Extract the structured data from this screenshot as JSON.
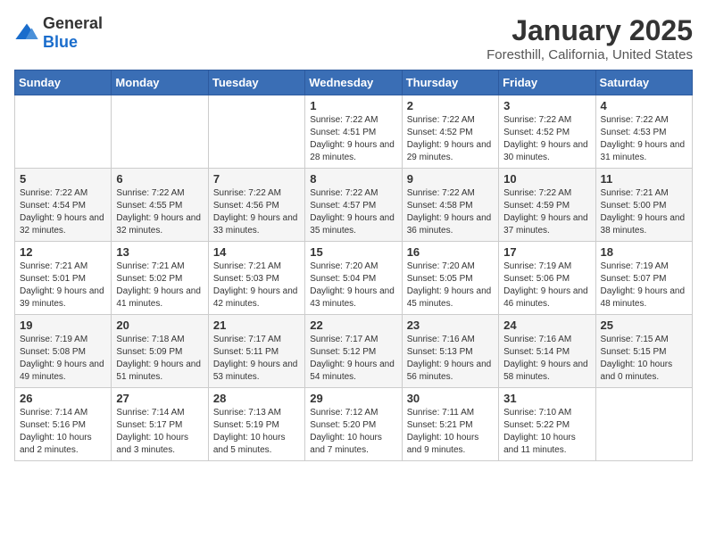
{
  "logo": {
    "general": "General",
    "blue": "Blue"
  },
  "title": "January 2025",
  "subtitle": "Foresthill, California, United States",
  "weekdays": [
    "Sunday",
    "Monday",
    "Tuesday",
    "Wednesday",
    "Thursday",
    "Friday",
    "Saturday"
  ],
  "weeks": [
    [
      {
        "day": "",
        "info": ""
      },
      {
        "day": "",
        "info": ""
      },
      {
        "day": "",
        "info": ""
      },
      {
        "day": "1",
        "info": "Sunrise: 7:22 AM\nSunset: 4:51 PM\nDaylight: 9 hours and 28 minutes."
      },
      {
        "day": "2",
        "info": "Sunrise: 7:22 AM\nSunset: 4:52 PM\nDaylight: 9 hours and 29 minutes."
      },
      {
        "day": "3",
        "info": "Sunrise: 7:22 AM\nSunset: 4:52 PM\nDaylight: 9 hours and 30 minutes."
      },
      {
        "day": "4",
        "info": "Sunrise: 7:22 AM\nSunset: 4:53 PM\nDaylight: 9 hours and 31 minutes."
      }
    ],
    [
      {
        "day": "5",
        "info": "Sunrise: 7:22 AM\nSunset: 4:54 PM\nDaylight: 9 hours and 32 minutes."
      },
      {
        "day": "6",
        "info": "Sunrise: 7:22 AM\nSunset: 4:55 PM\nDaylight: 9 hours and 32 minutes."
      },
      {
        "day": "7",
        "info": "Sunrise: 7:22 AM\nSunset: 4:56 PM\nDaylight: 9 hours and 33 minutes."
      },
      {
        "day": "8",
        "info": "Sunrise: 7:22 AM\nSunset: 4:57 PM\nDaylight: 9 hours and 35 minutes."
      },
      {
        "day": "9",
        "info": "Sunrise: 7:22 AM\nSunset: 4:58 PM\nDaylight: 9 hours and 36 minutes."
      },
      {
        "day": "10",
        "info": "Sunrise: 7:22 AM\nSunset: 4:59 PM\nDaylight: 9 hours and 37 minutes."
      },
      {
        "day": "11",
        "info": "Sunrise: 7:21 AM\nSunset: 5:00 PM\nDaylight: 9 hours and 38 minutes."
      }
    ],
    [
      {
        "day": "12",
        "info": "Sunrise: 7:21 AM\nSunset: 5:01 PM\nDaylight: 9 hours and 39 minutes."
      },
      {
        "day": "13",
        "info": "Sunrise: 7:21 AM\nSunset: 5:02 PM\nDaylight: 9 hours and 41 minutes."
      },
      {
        "day": "14",
        "info": "Sunrise: 7:21 AM\nSunset: 5:03 PM\nDaylight: 9 hours and 42 minutes."
      },
      {
        "day": "15",
        "info": "Sunrise: 7:20 AM\nSunset: 5:04 PM\nDaylight: 9 hours and 43 minutes."
      },
      {
        "day": "16",
        "info": "Sunrise: 7:20 AM\nSunset: 5:05 PM\nDaylight: 9 hours and 45 minutes."
      },
      {
        "day": "17",
        "info": "Sunrise: 7:19 AM\nSunset: 5:06 PM\nDaylight: 9 hours and 46 minutes."
      },
      {
        "day": "18",
        "info": "Sunrise: 7:19 AM\nSunset: 5:07 PM\nDaylight: 9 hours and 48 minutes."
      }
    ],
    [
      {
        "day": "19",
        "info": "Sunrise: 7:19 AM\nSunset: 5:08 PM\nDaylight: 9 hours and 49 minutes."
      },
      {
        "day": "20",
        "info": "Sunrise: 7:18 AM\nSunset: 5:09 PM\nDaylight: 9 hours and 51 minutes."
      },
      {
        "day": "21",
        "info": "Sunrise: 7:17 AM\nSunset: 5:11 PM\nDaylight: 9 hours and 53 minutes."
      },
      {
        "day": "22",
        "info": "Sunrise: 7:17 AM\nSunset: 5:12 PM\nDaylight: 9 hours and 54 minutes."
      },
      {
        "day": "23",
        "info": "Sunrise: 7:16 AM\nSunset: 5:13 PM\nDaylight: 9 hours and 56 minutes."
      },
      {
        "day": "24",
        "info": "Sunrise: 7:16 AM\nSunset: 5:14 PM\nDaylight: 9 hours and 58 minutes."
      },
      {
        "day": "25",
        "info": "Sunrise: 7:15 AM\nSunset: 5:15 PM\nDaylight: 10 hours and 0 minutes."
      }
    ],
    [
      {
        "day": "26",
        "info": "Sunrise: 7:14 AM\nSunset: 5:16 PM\nDaylight: 10 hours and 2 minutes."
      },
      {
        "day": "27",
        "info": "Sunrise: 7:14 AM\nSunset: 5:17 PM\nDaylight: 10 hours and 3 minutes."
      },
      {
        "day": "28",
        "info": "Sunrise: 7:13 AM\nSunset: 5:19 PM\nDaylight: 10 hours and 5 minutes."
      },
      {
        "day": "29",
        "info": "Sunrise: 7:12 AM\nSunset: 5:20 PM\nDaylight: 10 hours and 7 minutes."
      },
      {
        "day": "30",
        "info": "Sunrise: 7:11 AM\nSunset: 5:21 PM\nDaylight: 10 hours and 9 minutes."
      },
      {
        "day": "31",
        "info": "Sunrise: 7:10 AM\nSunset: 5:22 PM\nDaylight: 10 hours and 11 minutes."
      },
      {
        "day": "",
        "info": ""
      }
    ]
  ]
}
